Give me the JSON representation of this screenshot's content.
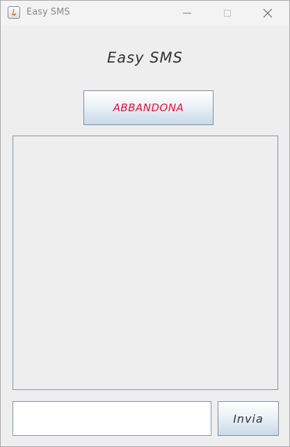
{
  "window": {
    "title": "Easy SMS",
    "controls": {
      "minimize": "minimize-icon",
      "maximize": "maximize-icon",
      "close": "close-icon"
    }
  },
  "main": {
    "heading": "Easy SMS",
    "abbandona_label": "ABBANDONA",
    "abbandona_color": "#e0103c",
    "message_log": "",
    "input_value": "",
    "input_placeholder": "",
    "send_label": "Invia"
  }
}
